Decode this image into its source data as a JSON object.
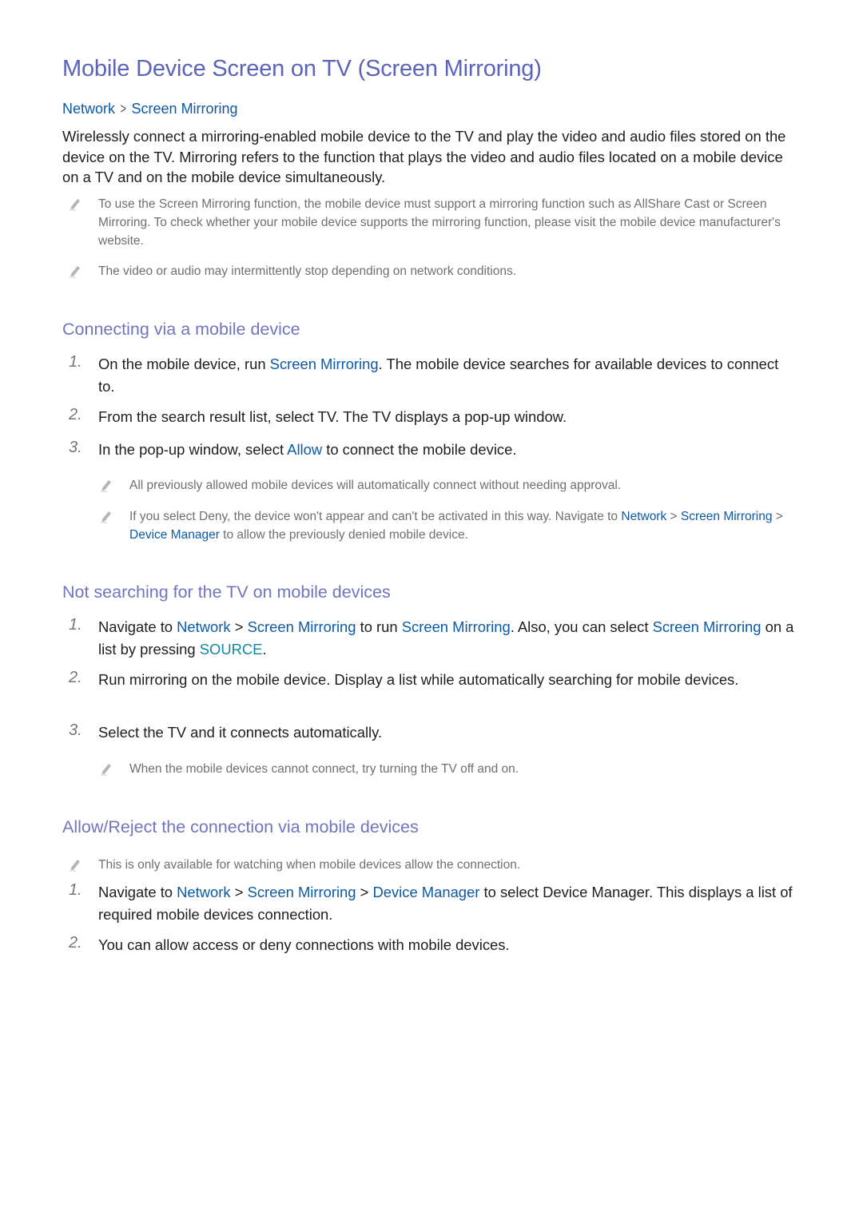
{
  "title": "Mobile Device Screen on TV (Screen Mirroring)",
  "path": {
    "items": [
      "Network",
      "Screen Mirroring"
    ],
    "separator": ">"
  },
  "intro": "Wirelessly connect a mirroring-enabled mobile device to the TV and play the video and audio files stored on the device on the TV. Mirroring refers to the function that plays the video and audio files located on a mobile device on a TV and on the mobile device simultaneously.",
  "intro_notes": [
    {
      "icon": "pencil-icon",
      "text": "To use the Screen Mirroring function, the mobile device must support a mirroring function such as AllShare Cast or Screen Mirroring. To check whether your mobile device supports the mirroring function, please visit the mobile device manufacturer's website."
    },
    {
      "icon": "pencil-icon",
      "text": "The video or audio may intermittently stop depending on network conditions."
    }
  ],
  "sections": [
    {
      "heading": "Connecting via a mobile device",
      "steps": [
        {
          "num": "1.",
          "parts": [
            "On the mobile device, run ",
            "Screen Mirroring",
            ". The mobile device searches for available devices to connect to."
          ]
        },
        {
          "num": "2.",
          "parts": [
            "From the search result list, select TV. The TV displays a pop-up window."
          ]
        },
        {
          "num": "3.",
          "parts": [
            "In the pop-up window, select ",
            "Allow",
            " to connect the mobile device."
          ]
        }
      ],
      "notes": [
        {
          "icon": "pencil-icon",
          "parts": [
            "All previously allowed mobile devices will automatically connect without needing approval."
          ]
        },
        {
          "icon": "pencil-icon",
          "parts": [
            "If you select Deny, the device won't appear and can't be activated in this way. Navigate to ",
            "Network",
            " > ",
            "Screen Mirroring",
            " > ",
            "Device Manager",
            " to allow the previously denied mobile device."
          ]
        }
      ]
    },
    {
      "heading": "Not searching for the TV on mobile devices",
      "steps": [
        {
          "num": "1.",
          "parts": [
            "Navigate to ",
            "Network",
            " > ",
            "Screen Mirroring",
            " to run ",
            "Screen Mirroring",
            ". Also, you can select ",
            "Screen Mirroring",
            " on a list by pressing ",
            "SOURCE",
            "."
          ]
        },
        {
          "num": "2.",
          "parts": [
            "Run mirroring on the mobile device. Display a list while automatically searching for mobile devices."
          ]
        },
        {
          "num": "3.",
          "parts": [
            "Select the TV and it connects automatically."
          ]
        }
      ],
      "notes": [
        {
          "icon": "pencil-icon",
          "parts": [
            "When the mobile devices cannot connect, try turning the TV off and on."
          ]
        }
      ]
    },
    {
      "heading": "Allow/Reject the connection via mobile devices",
      "notes": [
        {
          "icon": "pencil-icon",
          "parts": [
            "This is only available for watching when mobile devices allow the connection."
          ]
        }
      ],
      "steps": [
        {
          "num": "1.",
          "parts": [
            "Navigate to ",
            "Network",
            " > ",
            "Screen Mirroring",
            " > ",
            "Device Manager",
            " to select Device Manager. This displays a list of required mobile devices connection."
          ]
        },
        {
          "num": "2.",
          "parts": [
            "You can allow access or deny connections with mobile devices."
          ]
        }
      ]
    }
  ],
  "colors": {
    "title": "#5b64b8",
    "heading": "#7075bd",
    "link": "#0c5aa6",
    "button_key": "#10879a",
    "body": "#1e1e1e",
    "note": "#6f6f6f"
  }
}
